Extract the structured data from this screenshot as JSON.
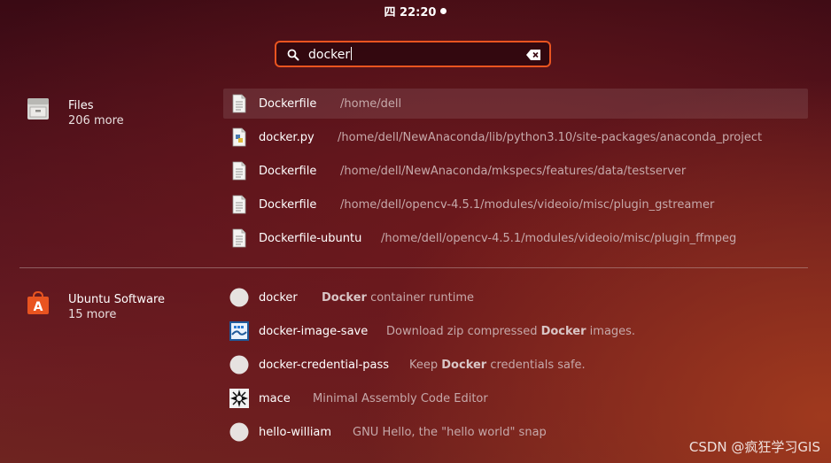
{
  "topbar": {
    "clock": "四 22:20"
  },
  "search": {
    "query": "docker"
  },
  "categories": [
    {
      "title": "Files",
      "more": "206 more",
      "icon": "file-cabinet-icon",
      "results": [
        {
          "name": "Dockerfile",
          "path": "/home/dell",
          "icon": "text-file-icon"
        },
        {
          "name": "docker.py",
          "path": "/home/dell/NewAnaconda/lib/python3.10/site-packages/anaconda_project",
          "icon": "python-file-icon"
        },
        {
          "name": "Dockerfile",
          "path": "/home/dell/NewAnaconda/mkspecs/features/data/testserver",
          "icon": "text-file-icon"
        },
        {
          "name": "Dockerfile",
          "path": "/home/dell/opencv-4.5.1/modules/videoio/misc/plugin_gstreamer",
          "icon": "text-file-icon"
        },
        {
          "name": "Dockerfile-ubuntu",
          "path": "/home/dell/opencv-4.5.1/modules/videoio/misc/plugin_ffmpeg",
          "icon": "text-file-icon"
        }
      ]
    },
    {
      "title": "Ubuntu Software",
      "more": "15 more",
      "icon": "ubuntu-software-icon",
      "results": [
        {
          "name": "docker",
          "desc_pre": "",
          "desc_bold": "Docker",
          "desc_post": " container runtime",
          "icon": "snap-generic-icon"
        },
        {
          "name": "docker-image-save",
          "desc_pre": "Download zip compressed ",
          "desc_bold": "Docker",
          "desc_post": " images.",
          "icon": "docker-image-save-icon"
        },
        {
          "name": "docker-credential-pass",
          "desc_pre": "Keep ",
          "desc_bold": "Docker",
          "desc_post": " credentials safe.",
          "icon": "snap-generic-icon"
        },
        {
          "name": "mace",
          "desc_pre": "Minimal Assembly Code Editor",
          "desc_bold": "",
          "desc_post": "",
          "icon": "mace-icon"
        },
        {
          "name": "hello-william",
          "desc_pre": "GNU Hello, the \"hello world\" snap",
          "desc_bold": "",
          "desc_post": "",
          "icon": "snap-generic-icon"
        }
      ]
    }
  ],
  "watermark": "CSDN @疯狂学习GIS",
  "colors": {
    "accent": "#e95420",
    "desc_text": "#c6a9aa"
  }
}
